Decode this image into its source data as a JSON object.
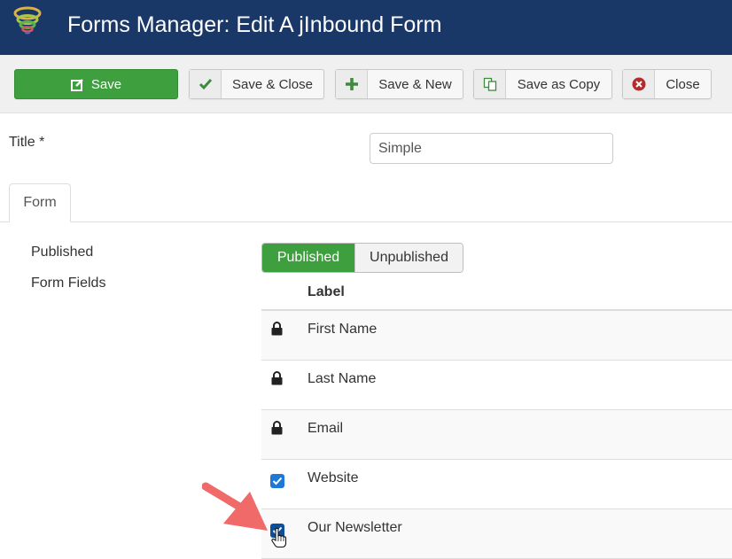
{
  "header": {
    "logo_icon": "jinbound-tornado-logo",
    "title": "Forms Manager: Edit A jInbound Form",
    "background": "#1a3867"
  },
  "toolbar": {
    "buttons": [
      {
        "label": "Save",
        "icon": "edit-icon",
        "style": "primary",
        "color": "#3d9f3d"
      },
      {
        "label": "Save & Close",
        "icon": "check-icon"
      },
      {
        "label": "Save & New",
        "icon": "plus-icon"
      },
      {
        "label": "Save as Copy",
        "icon": "copy-icon"
      },
      {
        "label": "Close",
        "icon": "close-circle-icon"
      }
    ]
  },
  "title_field": {
    "label": "Title *",
    "value": "Simple"
  },
  "tabs": [
    {
      "label": "Form",
      "active": true
    }
  ],
  "form": {
    "published_label": "Published",
    "form_fields_label": "Form Fields",
    "status_toggle": {
      "options": [
        "Published",
        "Unpublished"
      ],
      "selected": "Published",
      "active_color": "#3d9f3d"
    },
    "fields_table": {
      "column_header": "Label",
      "rows": [
        {
          "label": "First Name",
          "control": "lock-icon",
          "locked": true
        },
        {
          "label": "Last Name",
          "control": "lock-icon",
          "locked": true
        },
        {
          "label": "Email",
          "control": "lock-icon",
          "locked": true
        },
        {
          "label": "Website",
          "control": "checkbox",
          "checked": true
        },
        {
          "label": "Our Newsletter",
          "control": "checkbox",
          "checked": true
        }
      ]
    }
  },
  "annotations": {
    "arrow_icon": "red-arrow-pointer",
    "cursor_icon": "hand-cursor-icon",
    "arrow_color": "#f06a6a"
  }
}
